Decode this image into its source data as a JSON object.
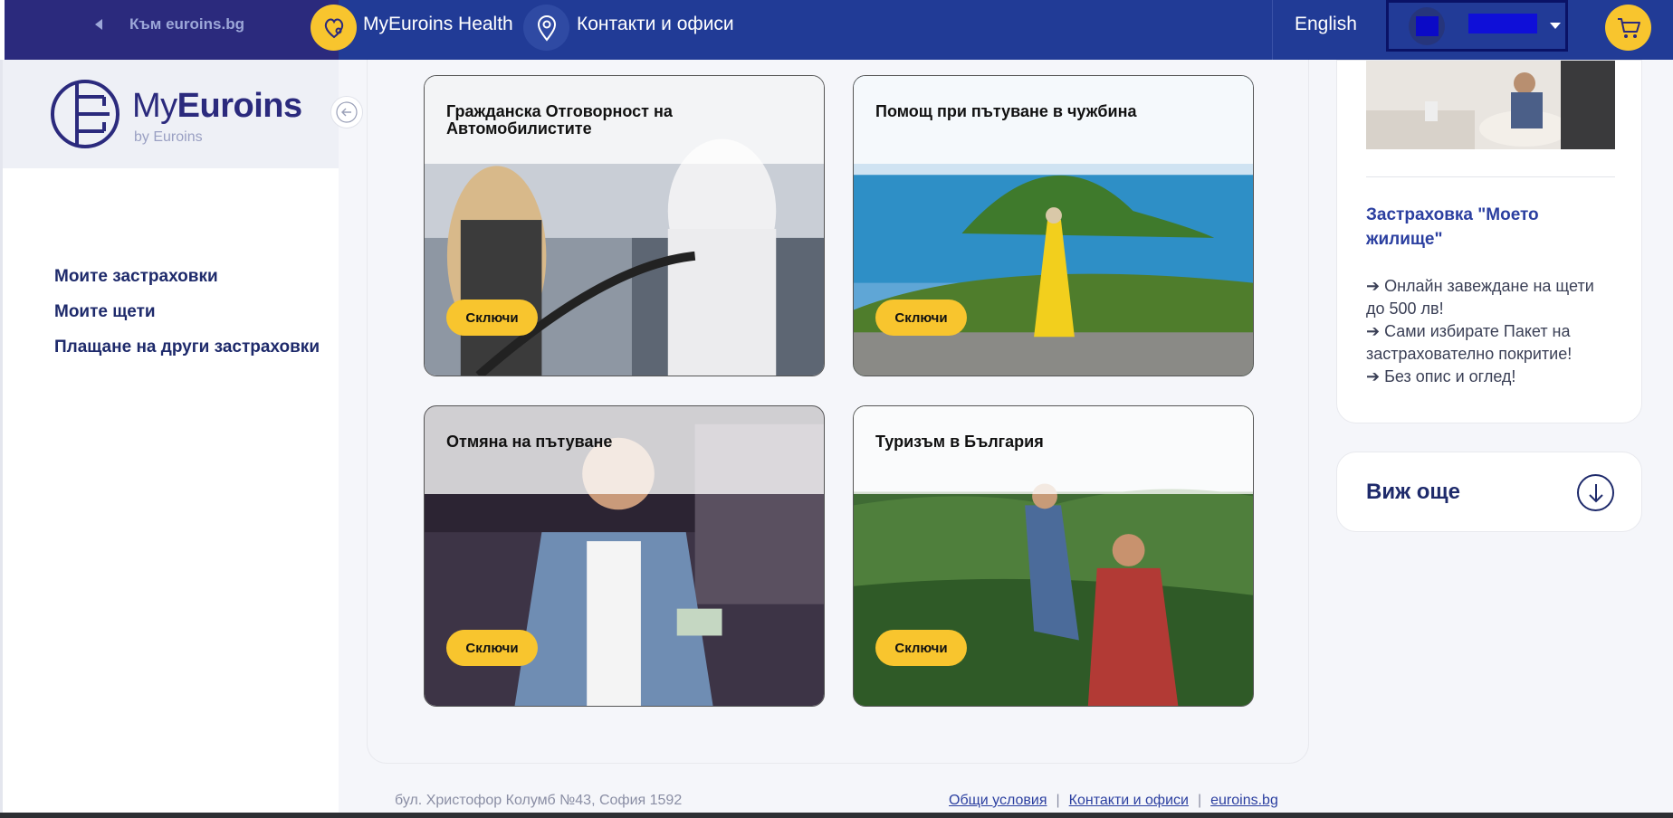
{
  "topbar": {
    "back_label": "Към euroins.bg",
    "health_label": "MyEuroins Health",
    "contacts_label": "Контакти и офиси",
    "language": "English"
  },
  "sidebar": {
    "logo_main": "MyEuroins",
    "logo_sub": "by Euroins",
    "items": [
      {
        "label": "Моите застраховки"
      },
      {
        "label": "Моите щети"
      },
      {
        "label": "Плащане на други застраховки"
      }
    ]
  },
  "products": [
    {
      "title": "Гражданска Отговорност на Автомобилистите",
      "button": "Сключи"
    },
    {
      "title": "Помощ при пътуване в чужбина",
      "button": "Сключи"
    },
    {
      "title": "Отмяна на пътуване",
      "button": "Сключи"
    },
    {
      "title": "Туризъм в България",
      "button": "Сключи"
    }
  ],
  "promo": {
    "title": "Застраховка \"Моето жилище\"",
    "lines": [
      "➔ Онлайн завеждане на щети до 500 лв!",
      "➔ Сами избирате Пакет на застрахователно покритие!",
      "➔ Без опис и оглед!"
    ]
  },
  "see_more": "Виж още",
  "footer": {
    "address": "бул. Христофор Колумб №43, София 1592",
    "links": [
      "Общи условия",
      "Контакти и офиси",
      "euroins.bg"
    ]
  },
  "colors": {
    "primary": "#213b96",
    "accent": "#f8c52e",
    "dark_navy": "#2b2a7d"
  }
}
